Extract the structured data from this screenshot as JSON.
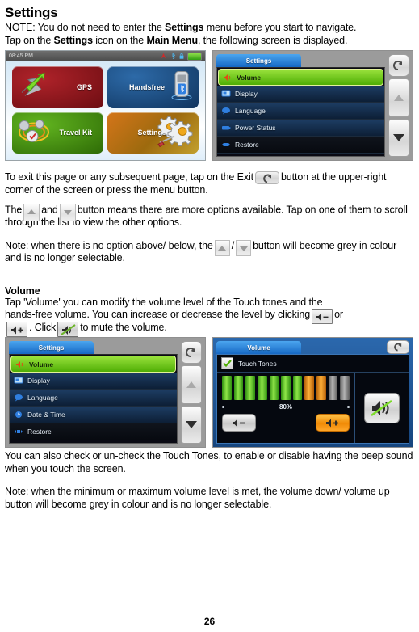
{
  "page": {
    "title": "Settings",
    "number": "26",
    "intro_line1_pre": "NOTE: You do not need to enter the ",
    "intro_line1_bold": "Settings",
    "intro_line1_post": " menu before you start to navigate.",
    "intro_line2_pre": "Tap on the ",
    "intro_line2_bold1": "Settings",
    "intro_line2_mid": " icon on the ",
    "intro_line2_bold2": "Main Menu",
    "intro_line2_post": ", the following screen is displayed."
  },
  "paragraphs": {
    "exit_pre": "To exit this page or any subsequent page, tap on the Exit",
    "exit_post": "button at the upper-right corner of the screen or press the menu button.",
    "scroll_pre": "The",
    "scroll_mid": "and",
    "scroll_post": "button means there are more options available. Tap on one of them to scroll through the list to view the other options.",
    "note_scroll_pre": "Note: when there is no option above/ below, the",
    "note_scroll_sep": "/",
    "note_scroll_post": "button will become grey in colour and is no longer selectable.",
    "volume_heading": "Volume",
    "volume_line1": "Tap 'Volume' you can modify the volume level of the Touch tones and the",
    "volume_line2_pre": "hands-free volume. You can increase or decrease the level by clicking",
    "volume_line2_or": "or",
    "volume_line3_pre": ". Click",
    "volume_line3_post": "to mute the volume.",
    "touch_tones_note": "You can also check or un-check the Touch Tones, to enable or disable having the beep sound when you touch the screen.",
    "minmax_note": "Note: when the minimum or maximum volume level is met, the volume down/ volume up button will become grey in colour and is no longer selectable."
  },
  "icons": {
    "exit": "back-arrow-icon",
    "scroll_up": "up-arrow-icon",
    "scroll_down": "down-arrow-icon",
    "volume_down": "speaker-minus-icon",
    "volume_up": "speaker-plus-icon",
    "mute": "speaker-mute-icon"
  },
  "main_menu_shot": {
    "clock": "08:45 PM",
    "tiles": [
      {
        "label": "GPS",
        "icon": "gps-arrow-icon",
        "color": "#8d1218"
      },
      {
        "label": "Handsfree",
        "icon": "phone-bluetooth-icon",
        "color": "#1d5089"
      },
      {
        "label": "Travel Kit",
        "icon": "travel-kit-icon",
        "color": "#4b9a12"
      },
      {
        "label": "Settings",
        "icon": "gears-icon",
        "color": "#bd7f16"
      }
    ]
  },
  "settings_shot_1": {
    "tab": "Settings",
    "items": [
      {
        "label": "Volume",
        "icon": "speaker-icon",
        "selected": true
      },
      {
        "label": "Display",
        "icon": "display-icon",
        "selected": false
      },
      {
        "label": "Language",
        "icon": "speech-bubble-icon",
        "selected": false
      },
      {
        "label": "Power Status",
        "icon": "battery-icon",
        "selected": false
      },
      {
        "label": "Restore",
        "icon": "restore-icon",
        "selected": false
      }
    ],
    "rail": {
      "exit": "back-arrow-icon",
      "up": "up-arrow-icon",
      "down": "down-arrow-icon"
    }
  },
  "settings_shot_2": {
    "tab": "Settings",
    "items": [
      {
        "label": "Volume",
        "icon": "speaker-icon",
        "selected": true
      },
      {
        "label": "Display",
        "icon": "display-icon",
        "selected": false
      },
      {
        "label": "Language",
        "icon": "speech-bubble-icon",
        "selected": false
      },
      {
        "label": "Date & Time",
        "icon": "clock-icon",
        "selected": false
      },
      {
        "label": "Restore",
        "icon": "restore-icon",
        "selected": false
      }
    ],
    "rail": {
      "exit": "back-arrow-icon",
      "up": "up-arrow-icon",
      "down": "down-arrow-icon"
    }
  },
  "volume_shot": {
    "tab": "Volume",
    "touch_tones_label": "Touch Tones",
    "touch_tones_checked": true,
    "level_percent": "80%",
    "bars": [
      "g",
      "g",
      "g",
      "g",
      "g",
      "g",
      "g",
      "o",
      "o",
      "x",
      "x"
    ],
    "volume_down_icon": "speaker-minus-icon",
    "volume_up_icon": "speaker-plus-icon",
    "mute_icon": "speaker-mute-icon",
    "exit_icon": "back-arrow-icon"
  }
}
